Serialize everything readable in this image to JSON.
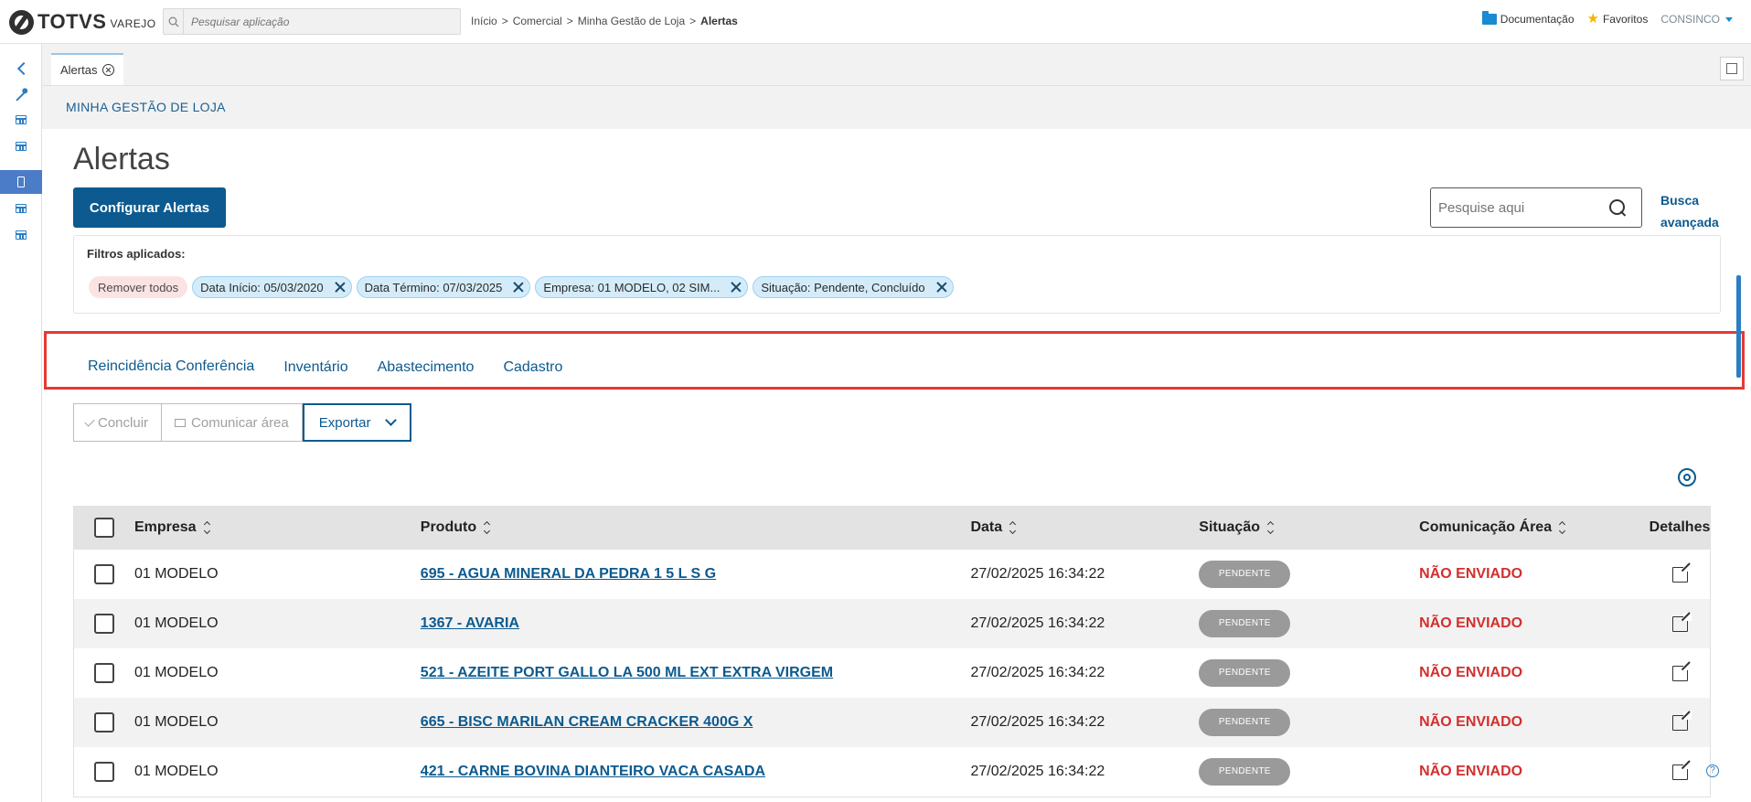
{
  "brand": {
    "name": "TOTVS",
    "sub": "VAREJO"
  },
  "top_search": {
    "placeholder": "Pesquisar aplicação"
  },
  "breadcrumb": [
    "Início",
    ">",
    "Comercial",
    ">",
    "Minha Gestão de Loja",
    ">",
    "Alertas"
  ],
  "top_links": {
    "docs": "Documentação",
    "favorites": "Favoritos",
    "user": "CONSINCO"
  },
  "page_tab": {
    "label": "Alertas"
  },
  "section": {
    "title": "MINHA GESTÃO DE LOJA"
  },
  "page": {
    "title": "Alertas",
    "configure_button": "Configurar Alertas"
  },
  "search": {
    "placeholder": "Pesquise aqui",
    "advanced_label": "Busca avançada"
  },
  "filters": {
    "label": "Filtros aplicados:",
    "remove_all": "Remover todos",
    "chips": [
      "Data Início: 05/03/2020",
      "Data Término: 07/03/2025",
      "Empresa: 01 MODELO, 02 SIM...",
      "Situação: Pendente, Concluído"
    ]
  },
  "tabs": [
    "Reincidência Conferência",
    "Inventário",
    "Abastecimento",
    "Cadastro"
  ],
  "actions": {
    "complete": "Concluir",
    "communicate": "Comunicar área",
    "export": "Exportar"
  },
  "table": {
    "columns": [
      "Empresa",
      "Produto",
      "Data",
      "Situação",
      "Comunicação Área",
      "Detalhes"
    ],
    "rows": [
      {
        "empresa": "01 MODELO",
        "produto": "695 - AGUA MINERAL DA PEDRA 1 5 L S G",
        "data": "27/02/2025 16:34:22",
        "situacao": "PENDENTE",
        "comunicacao": "NÃO ENVIADO"
      },
      {
        "empresa": "01 MODELO",
        "produto": "1367 - AVARIA",
        "data": "27/02/2025 16:34:22",
        "situacao": "PENDENTE",
        "comunicacao": "NÃO ENVIADO"
      },
      {
        "empresa": "01 MODELO",
        "produto": "521 - AZEITE PORT GALLO LA 500 ML EXT EXTRA VIRGEM",
        "data": "27/02/2025 16:34:22",
        "situacao": "PENDENTE",
        "comunicacao": "NÃO ENVIADO"
      },
      {
        "empresa": "01 MODELO",
        "produto": "665 - BISC MARILAN CREAM CRACKER 400G X",
        "data": "27/02/2025 16:34:22",
        "situacao": "PENDENTE",
        "comunicacao": "NÃO ENVIADO"
      },
      {
        "empresa": "01 MODELO",
        "produto": "421 - CARNE BOVINA DIANTEIRO VACA CASADA",
        "data": "27/02/2025 16:34:22",
        "situacao": "PENDENTE",
        "comunicacao": "NÃO ENVIADO"
      }
    ]
  },
  "colors": {
    "primary": "#0c5a8f",
    "danger": "#d32f2f",
    "highlight": "#e53935",
    "pill": "#9a9a9a"
  },
  "icons": [
    "search-icon",
    "folder-icon",
    "star-icon",
    "back-icon",
    "wand-icon",
    "grid-icon",
    "phone-icon",
    "close-icon",
    "gear-icon",
    "external-link-icon",
    "help-icon"
  ]
}
